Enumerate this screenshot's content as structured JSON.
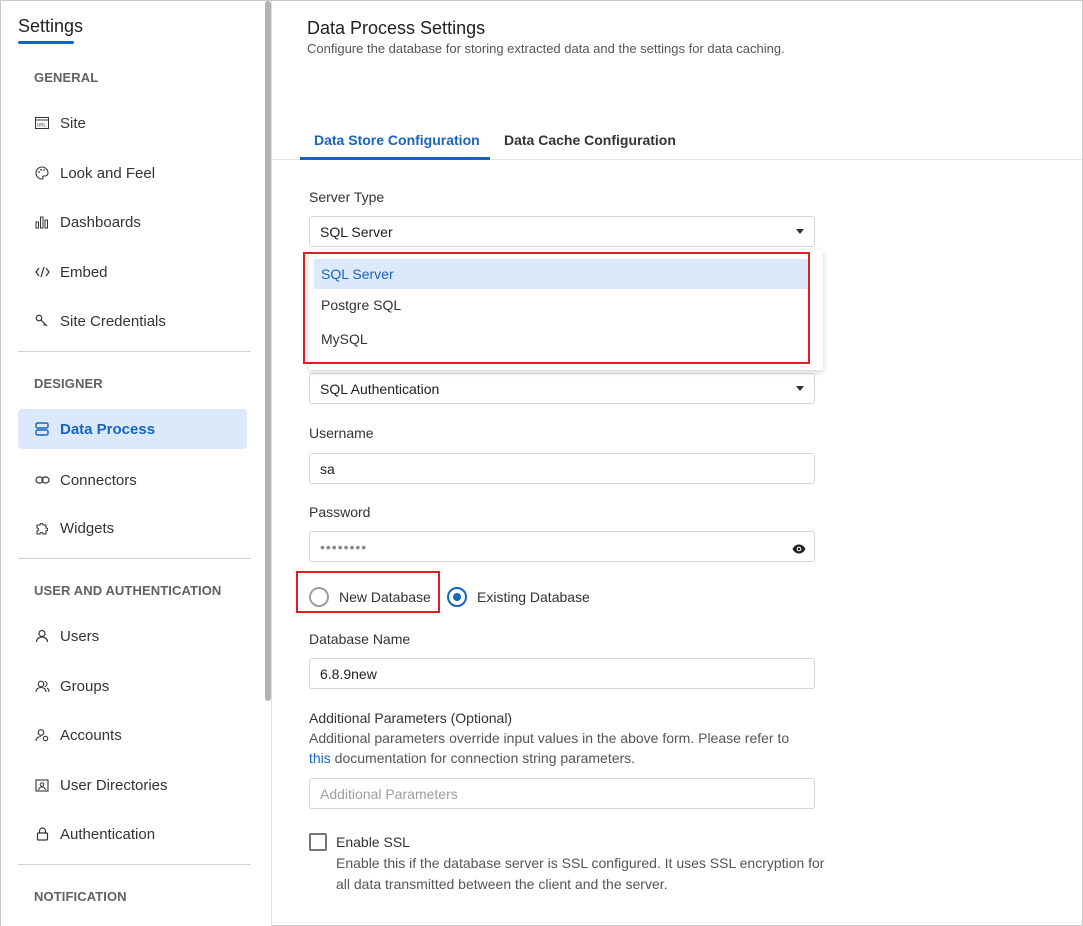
{
  "sidebar": {
    "title": "Settings",
    "sections": {
      "general": "GENERAL",
      "designer": "DESIGNER",
      "user_auth": "USER AND AUTHENTICATION",
      "notification": "NOTIFICATION"
    },
    "items": {
      "site": "Site",
      "look_and_feel": "Look and Feel",
      "dashboards": "Dashboards",
      "embed": "Embed",
      "site_credentials": "Site Credentials",
      "data_process": "Data Process",
      "connectors": "Connectors",
      "widgets": "Widgets",
      "users": "Users",
      "groups": "Groups",
      "accounts": "Accounts",
      "user_directories": "User Directories",
      "authentication": "Authentication"
    },
    "active_item": "Data Process"
  },
  "header": {
    "title": "Data Process Settings",
    "subtitle": "Configure the database for storing extracted data and the settings for data caching."
  },
  "tabs": {
    "data_store": "Data Store Configuration",
    "data_cache": "Data Cache Configuration",
    "active": "Data Store Configuration"
  },
  "form": {
    "server_type_label": "Server Type",
    "server_type_value": "SQL Server",
    "server_type_options": [
      "SQL Server",
      "Postgre SQL",
      "MySQL"
    ],
    "auth_value": "SQL Authentication",
    "username_label": "Username",
    "username_value": "sa",
    "password_label": "Password",
    "password_value": "••••••••",
    "radio_new_db": "New Database",
    "radio_existing_db": "Existing Database",
    "selected_radio": "Existing Database",
    "db_name_label": "Database Name",
    "db_name_value": "6.8.9new",
    "additional_label": "Additional Parameters (Optional)",
    "additional_help_1": "Additional parameters override input values in the above form. Please refer to",
    "additional_help_link": "this",
    "additional_help_2": " documentation for connection string parameters.",
    "additional_placeholder": "Additional Parameters",
    "ssl_label": "Enable SSL",
    "ssl_help": "Enable this if the database server is SSL configured. It uses SSL encryption for all data transmitted between the client and the server.",
    "ssl_checked": false
  },
  "colors": {
    "accent": "#1565c0",
    "highlight_box": "#e02020",
    "active_bg": "#dbe9fb"
  }
}
